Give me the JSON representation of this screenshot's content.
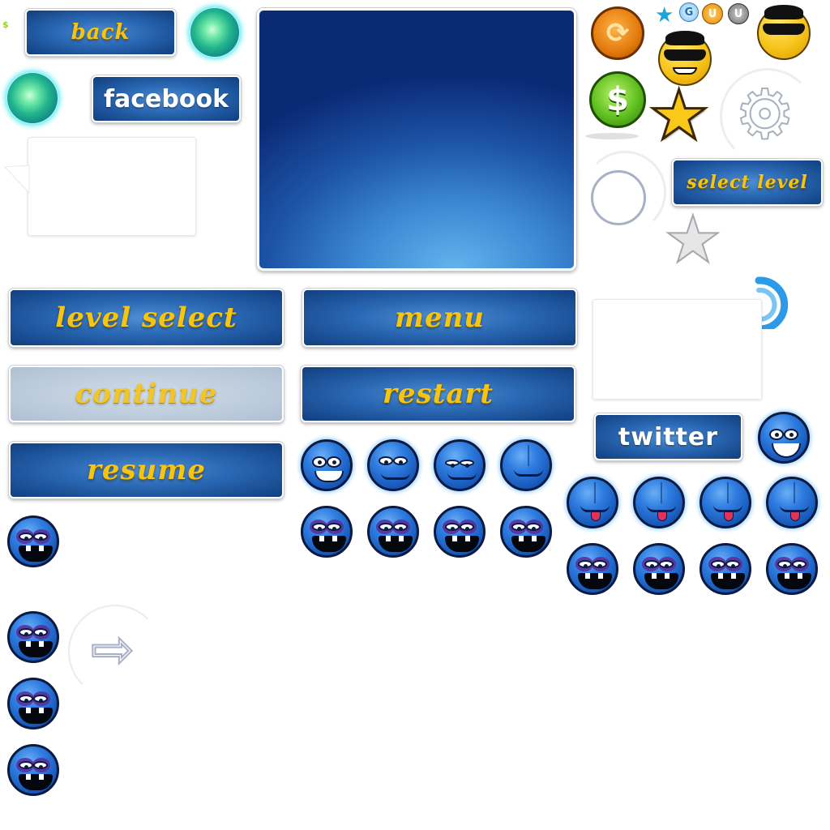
{
  "buttons": {
    "back": "back",
    "facebook": "facebook",
    "select_level": "select level",
    "level_select": "level select",
    "menu": "menu",
    "continue": "continue",
    "restart": "restart",
    "resume": "resume",
    "twitter": "twitter"
  },
  "icons": {
    "dollar": "$",
    "dollar_small": "$",
    "magnet_1": "U",
    "magnet_2": "U",
    "star": "★",
    "star_gray": "★",
    "spiral": "G",
    "gear": "⚙",
    "arrow_right": "⇨"
  },
  "colors": {
    "button_blue": "#1d5aa6",
    "button_text_gold": "#f6c413",
    "face_blue": "#2f7de0",
    "orb_teal": "#22b58e"
  }
}
